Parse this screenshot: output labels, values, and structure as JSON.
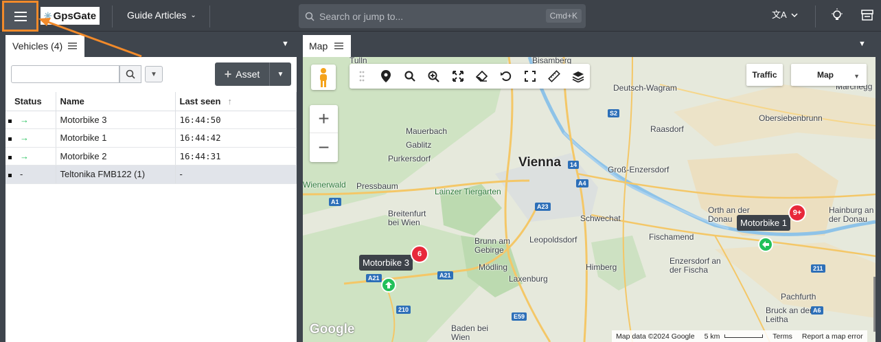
{
  "topbar": {
    "logo_text": "GpsGate",
    "guide_label": "Guide Articles",
    "search_placeholder": "Search or jump to...",
    "search_shortcut": "Cmd+K"
  },
  "left_panel": {
    "tab_label": "Vehicles (4)",
    "asset_button": "Asset",
    "filter_value": "",
    "columns": [
      "Status",
      "Name",
      "Last seen"
    ],
    "rows": [
      {
        "status": "→",
        "name": "Motorbike 3",
        "last_seen": "16:44:50"
      },
      {
        "status": "→",
        "name": "Motorbike 1",
        "last_seen": "16:44:42"
      },
      {
        "status": "→",
        "name": "Motorbike 2",
        "last_seen": "16:44:31"
      },
      {
        "status": "-",
        "name": "Teltonika FMB122 (1)",
        "last_seen": "-"
      }
    ]
  },
  "map_panel": {
    "tab_label": "Map",
    "traffic_label": "Traffic",
    "map_type": "Map",
    "vehicle_labels": [
      "Motorbike 3",
      "Motorbike 1"
    ],
    "cluster_counts": [
      "6",
      "9+"
    ],
    "places": [
      "Vienna",
      "Tulln",
      "Bisamberg",
      "Deutsch-Wagram",
      "Mauerbach",
      "Gablitz",
      "Purkersdorf",
      "Raasdorf",
      "Obersiebenbrunn",
      "Marchegg",
      "Groß-Enzersdorf",
      "Pressbaum",
      "Lainzer Tiergarten",
      "Breitenfurt bei Wien",
      "Schwechat",
      "Brunn am Gebirge",
      "Leopoldsdorf",
      "Fischamend",
      "Orth an der Donau",
      "Hainburg an der Donau",
      "Mödling",
      "Himberg",
      "Laxenburg",
      "Enzersdorf an der Fischa",
      "Pachfurth",
      "Bruck an der Leitha",
      "Baden bei Wien",
      "Wienerwald"
    ],
    "footer_data": "Map data ©2024 Google",
    "footer_scale": "5 km",
    "footer_terms": "Terms",
    "footer_report": "Report a map error",
    "google_mark": "Google"
  },
  "colors": {
    "accent": "#f28a2a",
    "status_ok": "#22c05a",
    "badge": "#e8283a",
    "topbar": "#3d4249"
  }
}
